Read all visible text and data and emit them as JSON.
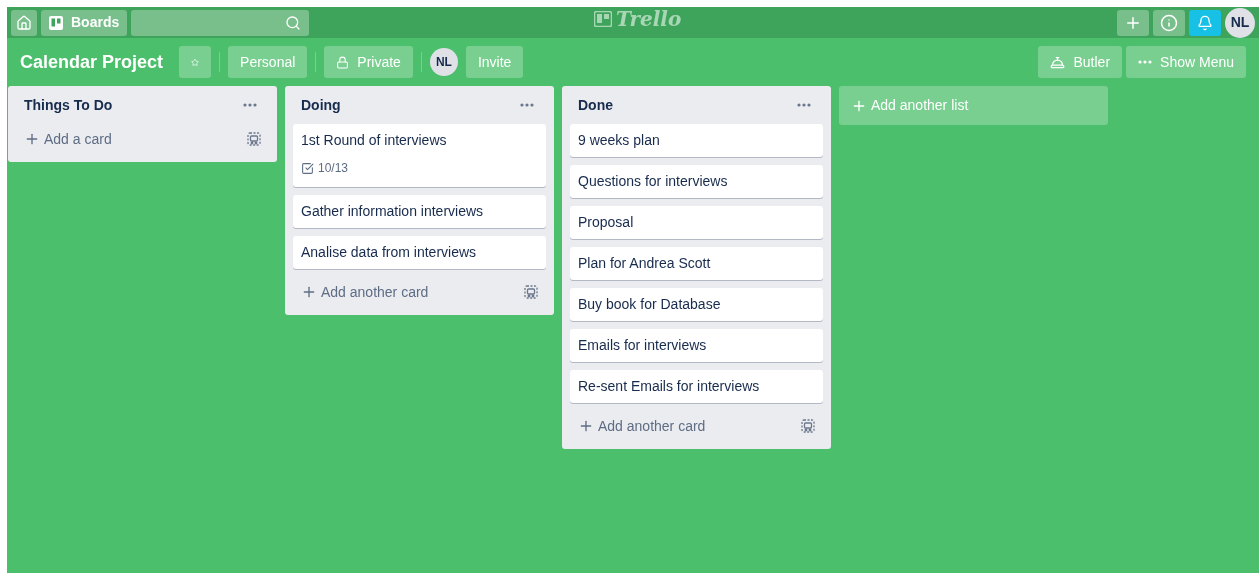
{
  "header": {
    "boards_label": "Boards",
    "logo": "Trello",
    "avatar": "NL",
    "notifications_active": true
  },
  "board": {
    "title": "Calendar Project",
    "starred": false,
    "team": "Personal",
    "visibility": "Private",
    "member": "NL",
    "invite": "Invite",
    "butler": "Butler",
    "show_menu": "Show Menu"
  },
  "lists": [
    {
      "title": "Things To Do",
      "add_label": "Add a card"
    },
    {
      "title": "Doing",
      "cards": [
        {
          "title": "1st Round of interviews",
          "checklist": "10/13"
        },
        {
          "title": "Gather information interviews"
        },
        {
          "title": "Analise data from interviews"
        }
      ],
      "add_label": "Add another card"
    },
    {
      "title": "Done",
      "cards": [
        {
          "title": "9 weeks plan"
        },
        {
          "title": "Questions for interviews"
        },
        {
          "title": "Proposal"
        },
        {
          "title": "Plan for Andrea Scott"
        },
        {
          "title": "Buy book for Database"
        },
        {
          "title": "Emails for interviews"
        },
        {
          "title": "Re-sent Emails for interviews"
        }
      ],
      "add_label": "Add another card"
    }
  ],
  "add_list": "Add another list"
}
